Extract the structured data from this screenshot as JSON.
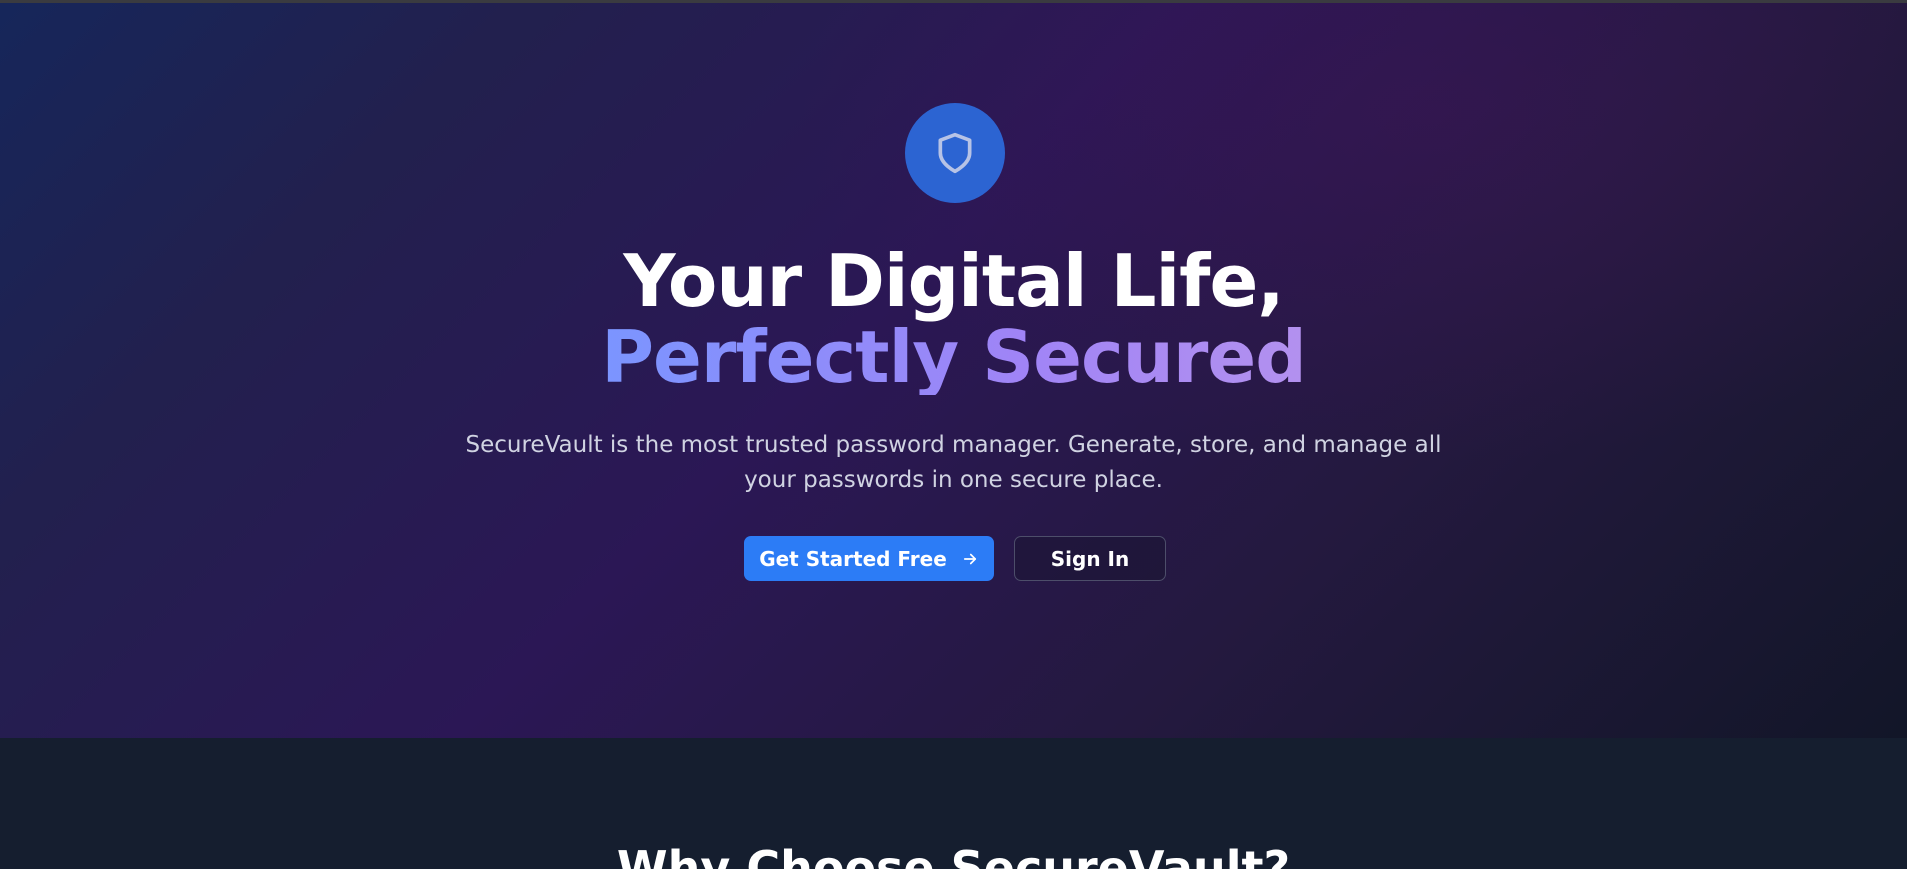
{
  "hero": {
    "icon": "shield-icon",
    "headline_line1": "Your Digital Life,",
    "headline_line2": "Perfectly Secured",
    "description_line1": "SecureVault is the most trusted password manager. Generate, store, and manage all",
    "description_line2": "your passwords in one secure place.",
    "primary_button": {
      "label": "Get Started Free",
      "icon": "arrow-right-icon"
    },
    "secondary_button": {
      "label": "Sign In"
    }
  },
  "features": {
    "title": "Why Choose SecureVault?"
  },
  "colors": {
    "accent": "#2c7cf6",
    "shield_circle": "#2c64d2",
    "gradient_text_start": "#7b95ff",
    "gradient_text_end": "#b391ef",
    "section_background": "#151e2f"
  }
}
